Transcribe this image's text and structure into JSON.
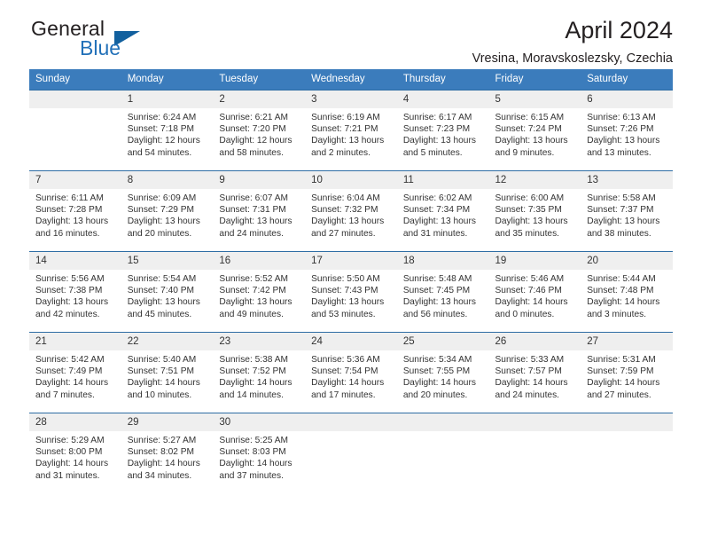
{
  "brand": {
    "name_part1": "General",
    "name_part2": "Blue",
    "triangle_color": "#12609e",
    "blue_color": "#2170b8"
  },
  "header": {
    "title": "April 2024",
    "subtitle": "Vresina, Moravskoslezsky, Czechia"
  },
  "theme": {
    "header_row_bg": "#3b7cbc",
    "week_divider": "#2e6da4",
    "daynum_bg": "#efefef",
    "text": "#333333"
  },
  "weekdays": [
    "Sunday",
    "Monday",
    "Tuesday",
    "Wednesday",
    "Thursday",
    "Friday",
    "Saturday"
  ],
  "weeks": [
    [
      {
        "day": "",
        "sunrise": "",
        "sunset": "",
        "daylight1": "",
        "daylight2": ""
      },
      {
        "day": "1",
        "sunrise": "Sunrise: 6:24 AM",
        "sunset": "Sunset: 7:18 PM",
        "daylight1": "Daylight: 12 hours",
        "daylight2": "and 54 minutes."
      },
      {
        "day": "2",
        "sunrise": "Sunrise: 6:21 AM",
        "sunset": "Sunset: 7:20 PM",
        "daylight1": "Daylight: 12 hours",
        "daylight2": "and 58 minutes."
      },
      {
        "day": "3",
        "sunrise": "Sunrise: 6:19 AM",
        "sunset": "Sunset: 7:21 PM",
        "daylight1": "Daylight: 13 hours",
        "daylight2": "and 2 minutes."
      },
      {
        "day": "4",
        "sunrise": "Sunrise: 6:17 AM",
        "sunset": "Sunset: 7:23 PM",
        "daylight1": "Daylight: 13 hours",
        "daylight2": "and 5 minutes."
      },
      {
        "day": "5",
        "sunrise": "Sunrise: 6:15 AM",
        "sunset": "Sunset: 7:24 PM",
        "daylight1": "Daylight: 13 hours",
        "daylight2": "and 9 minutes."
      },
      {
        "day": "6",
        "sunrise": "Sunrise: 6:13 AM",
        "sunset": "Sunset: 7:26 PM",
        "daylight1": "Daylight: 13 hours",
        "daylight2": "and 13 minutes."
      }
    ],
    [
      {
        "day": "7",
        "sunrise": "Sunrise: 6:11 AM",
        "sunset": "Sunset: 7:28 PM",
        "daylight1": "Daylight: 13 hours",
        "daylight2": "and 16 minutes."
      },
      {
        "day": "8",
        "sunrise": "Sunrise: 6:09 AM",
        "sunset": "Sunset: 7:29 PM",
        "daylight1": "Daylight: 13 hours",
        "daylight2": "and 20 minutes."
      },
      {
        "day": "9",
        "sunrise": "Sunrise: 6:07 AM",
        "sunset": "Sunset: 7:31 PM",
        "daylight1": "Daylight: 13 hours",
        "daylight2": "and 24 minutes."
      },
      {
        "day": "10",
        "sunrise": "Sunrise: 6:04 AM",
        "sunset": "Sunset: 7:32 PM",
        "daylight1": "Daylight: 13 hours",
        "daylight2": "and 27 minutes."
      },
      {
        "day": "11",
        "sunrise": "Sunrise: 6:02 AM",
        "sunset": "Sunset: 7:34 PM",
        "daylight1": "Daylight: 13 hours",
        "daylight2": "and 31 minutes."
      },
      {
        "day": "12",
        "sunrise": "Sunrise: 6:00 AM",
        "sunset": "Sunset: 7:35 PM",
        "daylight1": "Daylight: 13 hours",
        "daylight2": "and 35 minutes."
      },
      {
        "day": "13",
        "sunrise": "Sunrise: 5:58 AM",
        "sunset": "Sunset: 7:37 PM",
        "daylight1": "Daylight: 13 hours",
        "daylight2": "and 38 minutes."
      }
    ],
    [
      {
        "day": "14",
        "sunrise": "Sunrise: 5:56 AM",
        "sunset": "Sunset: 7:38 PM",
        "daylight1": "Daylight: 13 hours",
        "daylight2": "and 42 minutes."
      },
      {
        "day": "15",
        "sunrise": "Sunrise: 5:54 AM",
        "sunset": "Sunset: 7:40 PM",
        "daylight1": "Daylight: 13 hours",
        "daylight2": "and 45 minutes."
      },
      {
        "day": "16",
        "sunrise": "Sunrise: 5:52 AM",
        "sunset": "Sunset: 7:42 PM",
        "daylight1": "Daylight: 13 hours",
        "daylight2": "and 49 minutes."
      },
      {
        "day": "17",
        "sunrise": "Sunrise: 5:50 AM",
        "sunset": "Sunset: 7:43 PM",
        "daylight1": "Daylight: 13 hours",
        "daylight2": "and 53 minutes."
      },
      {
        "day": "18",
        "sunrise": "Sunrise: 5:48 AM",
        "sunset": "Sunset: 7:45 PM",
        "daylight1": "Daylight: 13 hours",
        "daylight2": "and 56 minutes."
      },
      {
        "day": "19",
        "sunrise": "Sunrise: 5:46 AM",
        "sunset": "Sunset: 7:46 PM",
        "daylight1": "Daylight: 14 hours",
        "daylight2": "and 0 minutes."
      },
      {
        "day": "20",
        "sunrise": "Sunrise: 5:44 AM",
        "sunset": "Sunset: 7:48 PM",
        "daylight1": "Daylight: 14 hours",
        "daylight2": "and 3 minutes."
      }
    ],
    [
      {
        "day": "21",
        "sunrise": "Sunrise: 5:42 AM",
        "sunset": "Sunset: 7:49 PM",
        "daylight1": "Daylight: 14 hours",
        "daylight2": "and 7 minutes."
      },
      {
        "day": "22",
        "sunrise": "Sunrise: 5:40 AM",
        "sunset": "Sunset: 7:51 PM",
        "daylight1": "Daylight: 14 hours",
        "daylight2": "and 10 minutes."
      },
      {
        "day": "23",
        "sunrise": "Sunrise: 5:38 AM",
        "sunset": "Sunset: 7:52 PM",
        "daylight1": "Daylight: 14 hours",
        "daylight2": "and 14 minutes."
      },
      {
        "day": "24",
        "sunrise": "Sunrise: 5:36 AM",
        "sunset": "Sunset: 7:54 PM",
        "daylight1": "Daylight: 14 hours",
        "daylight2": "and 17 minutes."
      },
      {
        "day": "25",
        "sunrise": "Sunrise: 5:34 AM",
        "sunset": "Sunset: 7:55 PM",
        "daylight1": "Daylight: 14 hours",
        "daylight2": "and 20 minutes."
      },
      {
        "day": "26",
        "sunrise": "Sunrise: 5:33 AM",
        "sunset": "Sunset: 7:57 PM",
        "daylight1": "Daylight: 14 hours",
        "daylight2": "and 24 minutes."
      },
      {
        "day": "27",
        "sunrise": "Sunrise: 5:31 AM",
        "sunset": "Sunset: 7:59 PM",
        "daylight1": "Daylight: 14 hours",
        "daylight2": "and 27 minutes."
      }
    ],
    [
      {
        "day": "28",
        "sunrise": "Sunrise: 5:29 AM",
        "sunset": "Sunset: 8:00 PM",
        "daylight1": "Daylight: 14 hours",
        "daylight2": "and 31 minutes."
      },
      {
        "day": "29",
        "sunrise": "Sunrise: 5:27 AM",
        "sunset": "Sunset: 8:02 PM",
        "daylight1": "Daylight: 14 hours",
        "daylight2": "and 34 minutes."
      },
      {
        "day": "30",
        "sunrise": "Sunrise: 5:25 AM",
        "sunset": "Sunset: 8:03 PM",
        "daylight1": "Daylight: 14 hours",
        "daylight2": "and 37 minutes."
      },
      {
        "day": "",
        "sunrise": "",
        "sunset": "",
        "daylight1": "",
        "daylight2": ""
      },
      {
        "day": "",
        "sunrise": "",
        "sunset": "",
        "daylight1": "",
        "daylight2": ""
      },
      {
        "day": "",
        "sunrise": "",
        "sunset": "",
        "daylight1": "",
        "daylight2": ""
      },
      {
        "day": "",
        "sunrise": "",
        "sunset": "",
        "daylight1": "",
        "daylight2": ""
      }
    ]
  ]
}
